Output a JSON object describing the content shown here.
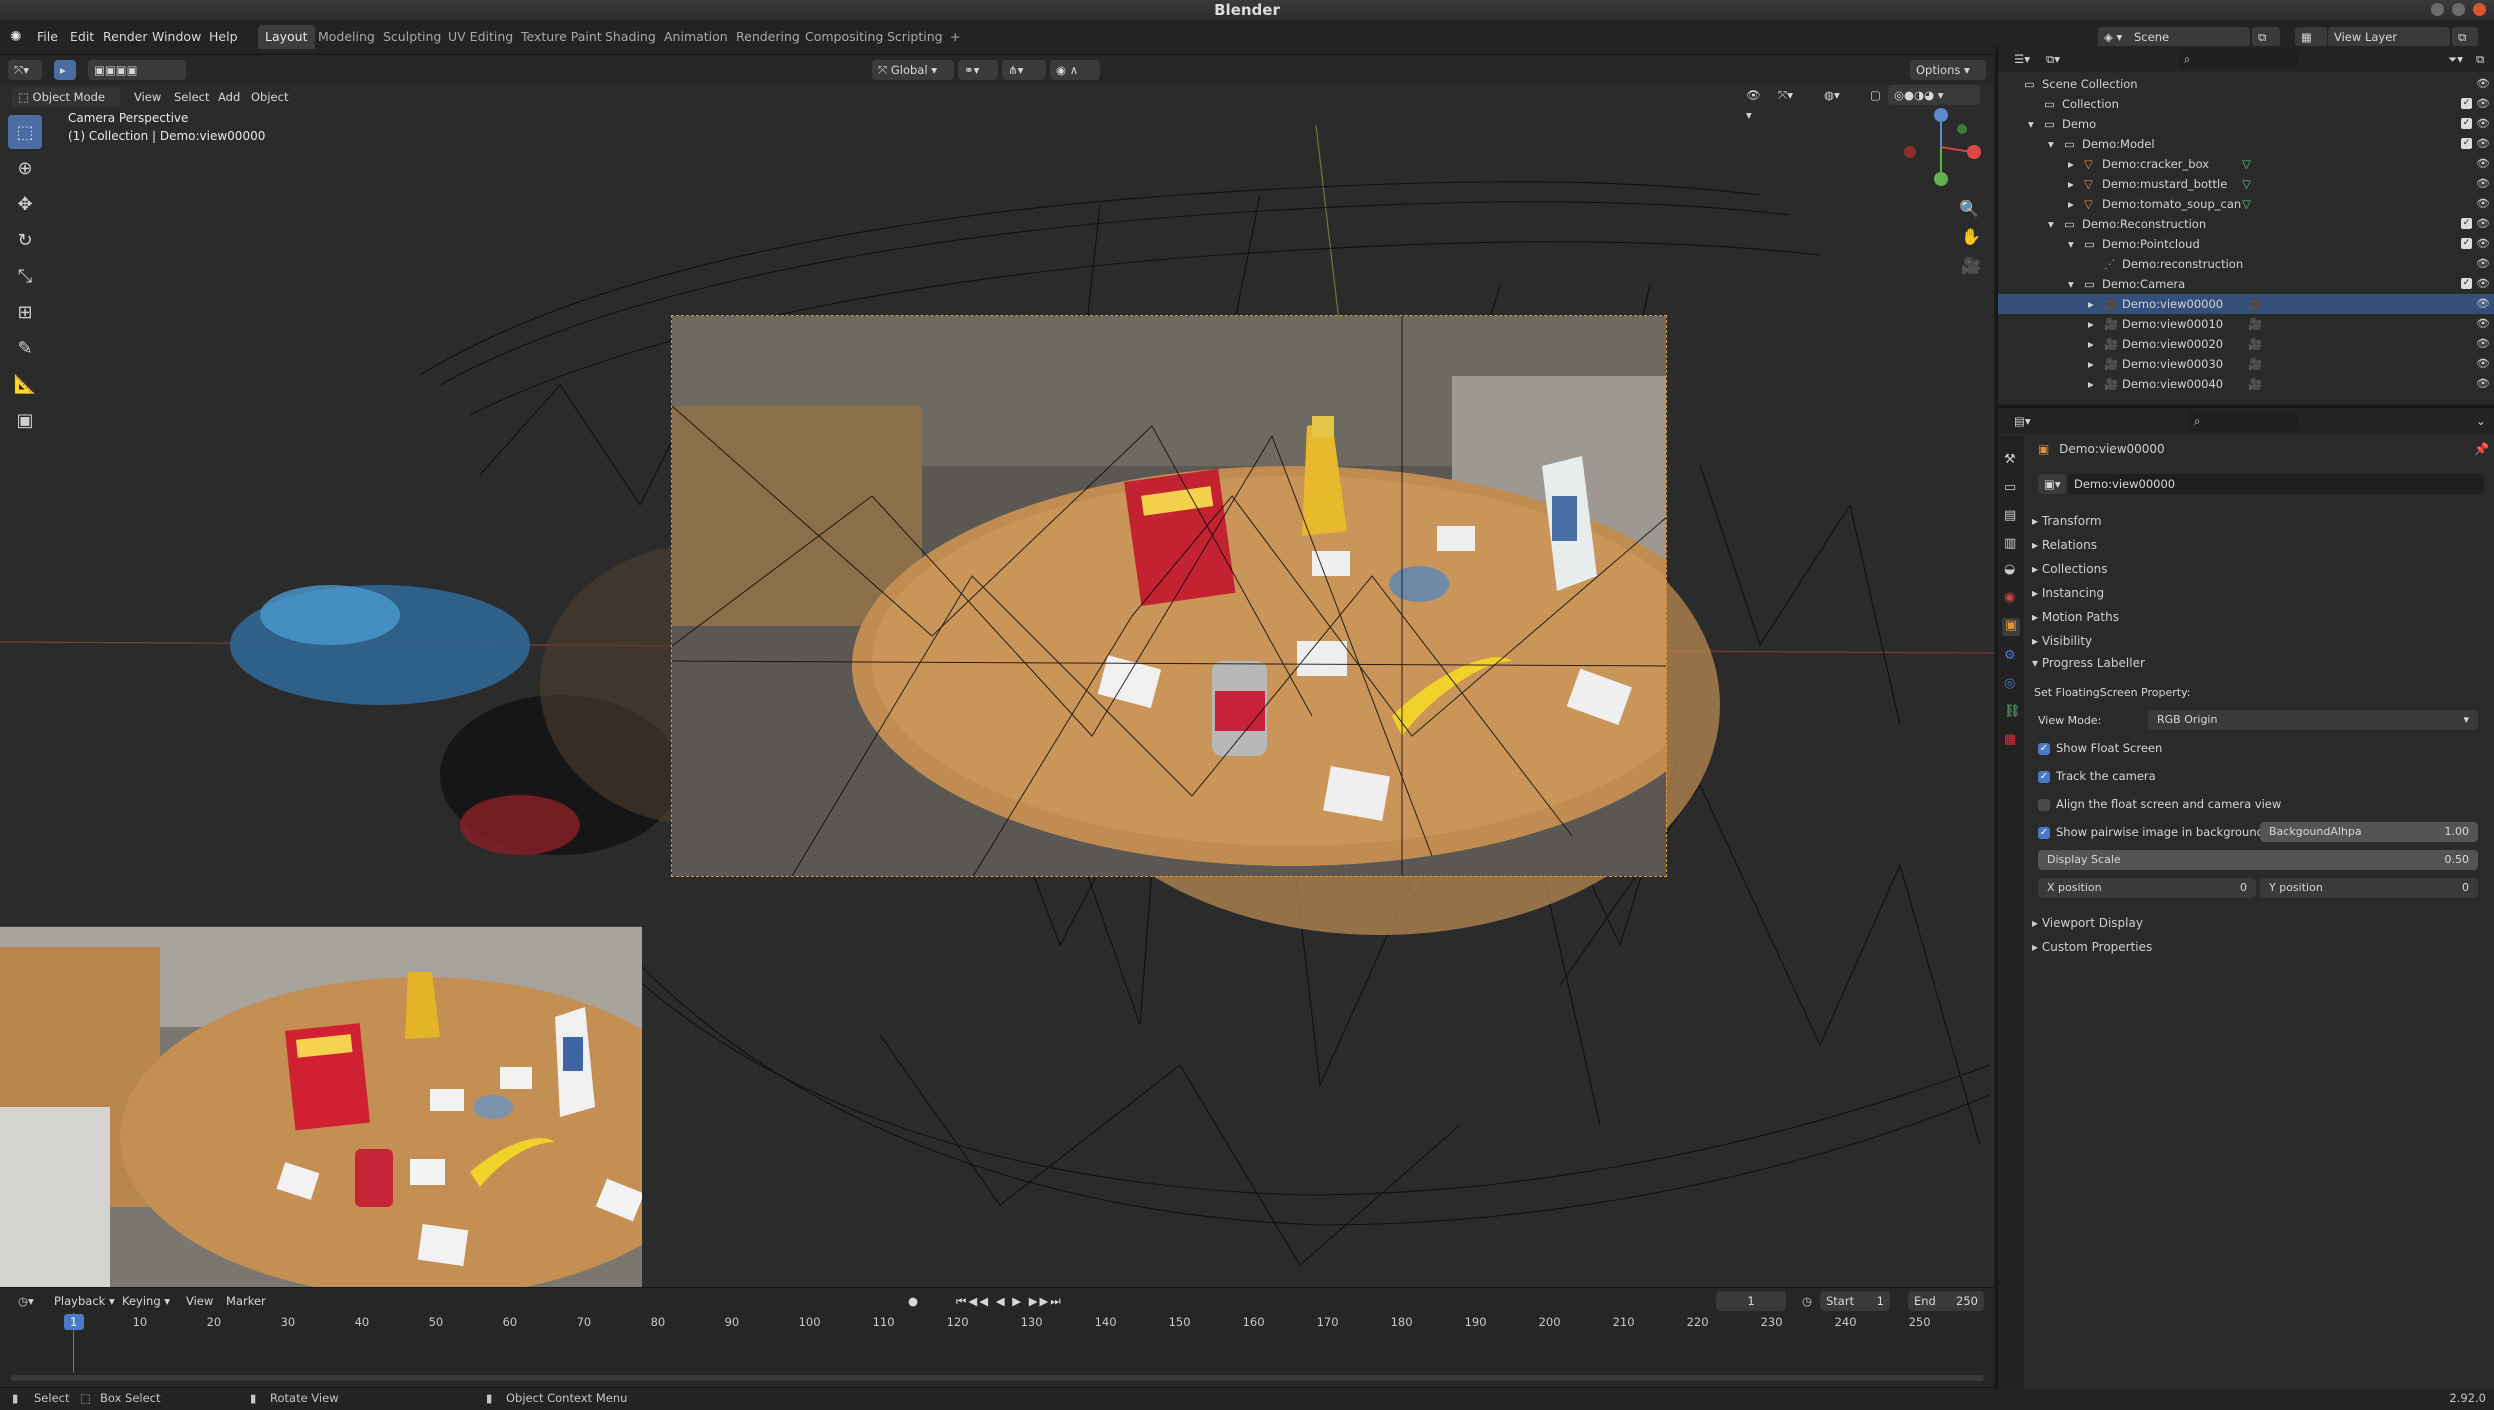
{
  "window": {
    "title": "Blender"
  },
  "menubar": {
    "menus": [
      "File",
      "Edit",
      "Render",
      "Window",
      "Help"
    ],
    "workspaces": [
      "Layout",
      "Modeling",
      "Sculpting",
      "UV Editing",
      "Texture Paint",
      "Shading",
      "Animation",
      "Rendering",
      "Compositing",
      "Scripting"
    ],
    "active_workspace": "Layout",
    "add_tab": "+",
    "scene": "Scene",
    "view_layer": "View Layer"
  },
  "header3d": {
    "orientation": "Global",
    "options": "Options",
    "mode": "Object Mode",
    "menus": [
      "View",
      "Select",
      "Add",
      "Object"
    ]
  },
  "viewport": {
    "overlay_line1": "Camera Perspective",
    "overlay_line2": "(1) Collection | Demo:view00000"
  },
  "timeline": {
    "menus": [
      "Playback",
      "Keying",
      "View",
      "Marker"
    ],
    "current_frame": "1",
    "start_label": "Start",
    "start_value": "1",
    "end_label": "End",
    "end_value": "250",
    "ticks": [
      "1",
      "10",
      "20",
      "30",
      "40",
      "50",
      "60",
      "70",
      "80",
      "90",
      "100",
      "110",
      "120",
      "130",
      "140",
      "150",
      "160",
      "170",
      "180",
      "190",
      "200",
      "210",
      "220",
      "230",
      "240",
      "250"
    ]
  },
  "statusbar": {
    "select": "Select",
    "box_select": "Box Select",
    "rotate_view": "Rotate View",
    "context_menu": "Object Context Menu",
    "version": "2.92.0"
  },
  "outliner": {
    "rows": [
      {
        "label": "Scene Collection",
        "indent": 0,
        "icon": "collection",
        "expand": ""
      },
      {
        "label": "Collection",
        "indent": 1,
        "icon": "collection",
        "expand": ""
      },
      {
        "label": "Demo",
        "indent": 1,
        "icon": "collection",
        "expand": "▾"
      },
      {
        "label": "Demo:Model",
        "indent": 2,
        "icon": "collection",
        "expand": "▾"
      },
      {
        "label": "Demo:cracker_box",
        "indent": 3,
        "icon": "mesh",
        "expand": "▸"
      },
      {
        "label": "Demo:mustard_bottle",
        "indent": 3,
        "icon": "mesh",
        "expand": "▸"
      },
      {
        "label": "Demo:tomato_soup_can",
        "indent": 3,
        "icon": "mesh",
        "expand": "▸"
      },
      {
        "label": "Demo:Reconstruction",
        "indent": 2,
        "icon": "collection",
        "expand": "▾"
      },
      {
        "label": "Demo:Pointcloud",
        "indent": 3,
        "icon": "collection",
        "expand": "▾"
      },
      {
        "label": "Demo:reconstruction",
        "indent": 4,
        "icon": "pointcloud",
        "expand": ""
      },
      {
        "label": "Demo:Camera",
        "indent": 3,
        "icon": "collection",
        "expand": "▾"
      },
      {
        "label": "Demo:view00000",
        "indent": 4,
        "icon": "camera",
        "expand": "▸",
        "selected": true
      },
      {
        "label": "Demo:view00010",
        "indent": 4,
        "icon": "camera",
        "expand": "▸"
      },
      {
        "label": "Demo:view00020",
        "indent": 4,
        "icon": "camera",
        "expand": "▸"
      },
      {
        "label": "Demo:view00030",
        "indent": 4,
        "icon": "camera",
        "expand": "▸"
      },
      {
        "label": "Demo:view00040",
        "indent": 4,
        "icon": "camera",
        "expand": "▸"
      }
    ]
  },
  "properties": {
    "object_name": "Demo:view00000",
    "data_name": "Demo:view00000",
    "sections": [
      "Transform",
      "Relations",
      "Collections",
      "Instancing",
      "Motion Paths",
      "Visibility"
    ],
    "progress_labeller": "Progress Labeller",
    "set_floating_label": "Set FloatingScreen Property:",
    "view_mode_label": "View Mode:",
    "view_mode_value": "RGB Origin",
    "show_float_screen": "Show Float Screen",
    "track_camera": "Track the camera",
    "align_float": "Align the float screen and camera view",
    "show_pairwise": "Show pairwise image in background",
    "background_alpha_label": "BackgoundAlhpa",
    "background_alpha_value": "1.00",
    "display_scale_label": "Display Scale",
    "display_scale_value": "0.50",
    "x_position_label": "X position",
    "x_position_value": "0",
    "y_position_label": "Y position",
    "y_position_value": "0",
    "bottom_sections": [
      "Viewport Display",
      "Custom Properties"
    ]
  },
  "colors": {
    "accent": "#4a79c6",
    "selection": "#334f7a",
    "camera_frame": "#e39232",
    "active_frame": "#4a79c6"
  }
}
